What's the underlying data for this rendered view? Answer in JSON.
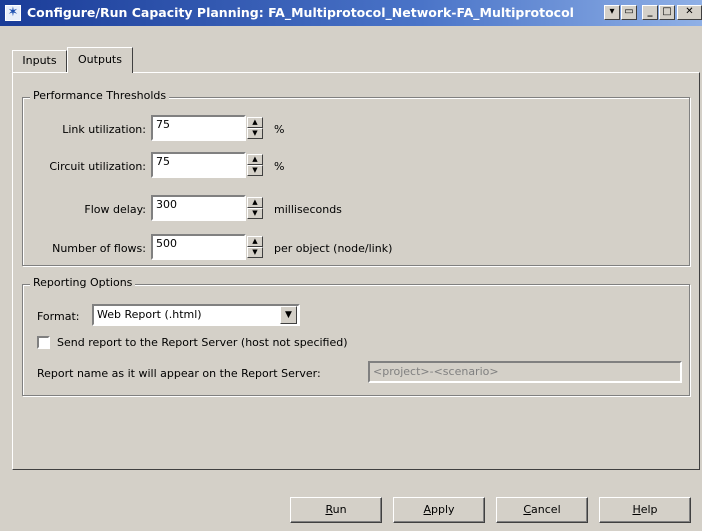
{
  "window": {
    "title": "Configure/Run Capacity Planning: FA_Multiprotocol_Network-FA_Multiprotocol",
    "icon": "star-icon",
    "controls": [
      "menu-arrow",
      "restore-small",
      "minimize",
      "maximize",
      "close"
    ]
  },
  "tabs": [
    {
      "label": "Inputs",
      "active": false
    },
    {
      "label": "Outputs",
      "active": true
    }
  ],
  "performance": {
    "title": "Performance Thresholds",
    "rows": [
      {
        "label": "Link utilization:",
        "value": "75",
        "unit": "%"
      },
      {
        "label": "Circuit utilization:",
        "value": "75",
        "unit": "%"
      },
      {
        "label": "Flow delay:",
        "value": "300",
        "unit": "milliseconds"
      },
      {
        "label": "Number of flows:",
        "value": "500",
        "unit": "per object (node/link)"
      }
    ]
  },
  "reporting": {
    "title": "Reporting Options",
    "format_label": "Format:",
    "format_value": "Web Report (.html)",
    "send_label": "Send report to the Report Server (host not specified)",
    "send_checked": false,
    "report_name_label": "Report name as it will appear on the Report Server:",
    "report_name_value": "<project>-<scenario>"
  },
  "buttons": {
    "run": {
      "accel": "R",
      "rest": "un"
    },
    "apply": {
      "accel": "A",
      "rest": "pply"
    },
    "cancel": {
      "accel": "C",
      "rest": "ancel"
    },
    "help": {
      "accel": "H",
      "rest": "elp"
    }
  }
}
